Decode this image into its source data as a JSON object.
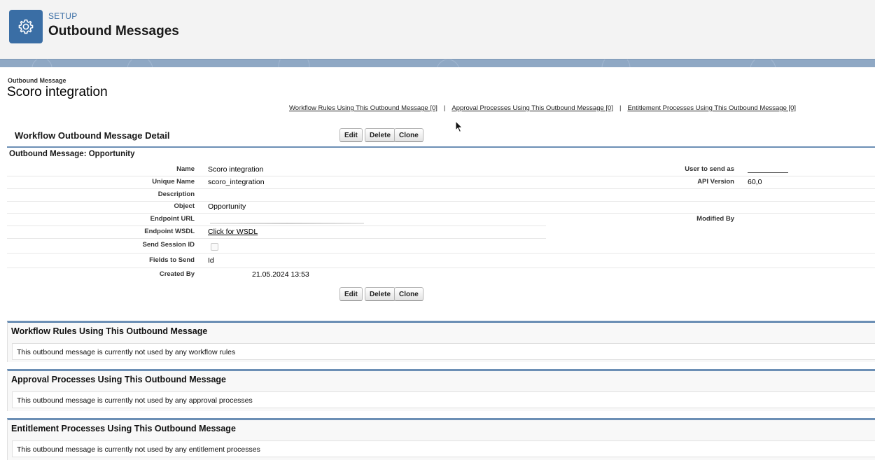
{
  "setup": {
    "eyebrow": "SETUP",
    "title": "Outbound Messages",
    "icon": "gear-icon",
    "accent": "#3a6ea5"
  },
  "page": {
    "eyebrow": "Outbound Message",
    "title": "Scoro integration"
  },
  "related_links": [
    {
      "label": "Workflow Rules Using This Outbound Message [0]"
    },
    {
      "label": "Approval Processes Using This Outbound Message [0]"
    },
    {
      "label": "Entitlement Processes Using This Outbound Message [0]"
    }
  ],
  "detail": {
    "title": "Workflow Outbound Message Detail",
    "buttons": {
      "edit": "Edit",
      "delete": "Delete",
      "clone": "Clone"
    },
    "section": "Outbound Message: Opportunity",
    "fields": {
      "name": {
        "label": "Name",
        "value": "Scoro integration"
      },
      "unique_name": {
        "label": "Unique Name",
        "value": "scoro_integration"
      },
      "description": {
        "label": "Description",
        "value": ""
      },
      "object": {
        "label": "Object",
        "value": "Opportunity"
      },
      "endpoint_url": {
        "label": "Endpoint URL",
        "value": ""
      },
      "endpoint_wsdl": {
        "label": "Endpoint WSDL",
        "value": "Click for WSDL"
      },
      "send_session_id": {
        "label": "Send Session ID",
        "checked": false
      },
      "fields_to_send": {
        "label": "Fields to Send",
        "value": "Id"
      },
      "created_by": {
        "label": "Created By",
        "value": "21.05.2024 13:53"
      },
      "user_to_send_as": {
        "label": "User to send as",
        "value": ""
      },
      "api_version": {
        "label": "API Version",
        "value": "60,0"
      },
      "modified_by": {
        "label": "Modified By",
        "value": ""
      }
    }
  },
  "related_lists": [
    {
      "title": "Workflow Rules Using This Outbound Message",
      "message": "This outbound message is currently not used by any workflow rules"
    },
    {
      "title": "Approval Processes Using This Outbound Message",
      "message": "This outbound message is currently not used by any approval processes"
    },
    {
      "title": "Entitlement Processes Using This Outbound Message",
      "message": "This outbound message is currently not used by any entitlement processes"
    }
  ]
}
